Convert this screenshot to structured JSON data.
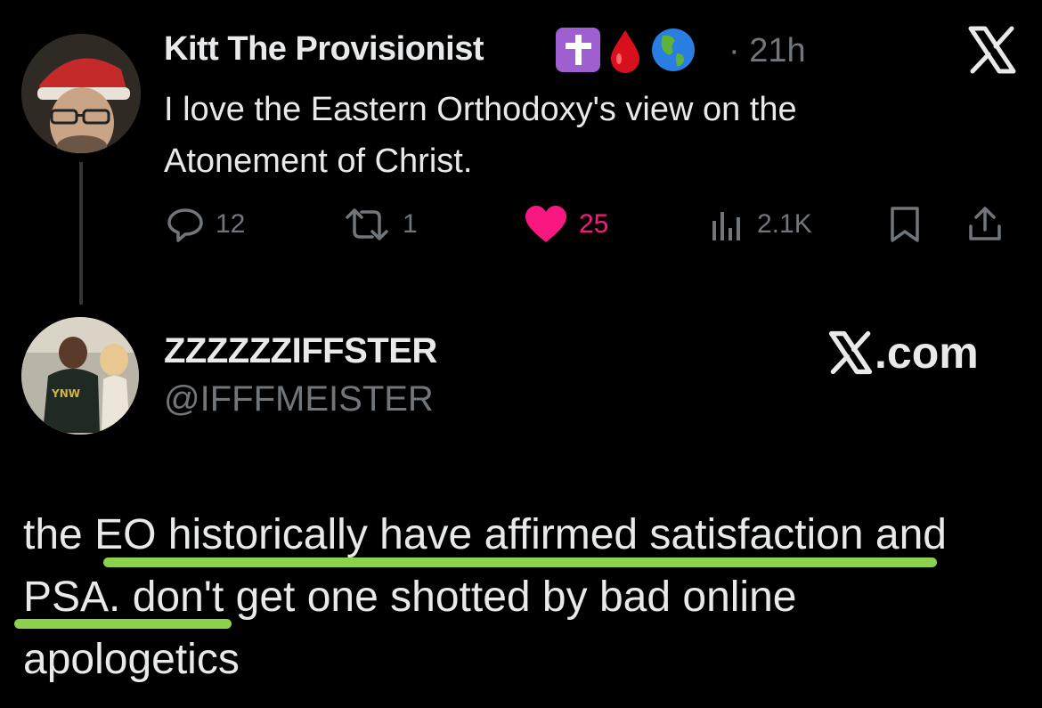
{
  "tweet": {
    "author_name": "Kitt The Provisionist",
    "badges": [
      "latin-cross-emoji",
      "drop-of-blood-emoji",
      "globe-americas-emoji"
    ],
    "separator": "·",
    "time": "21h",
    "text": "I love the Eastern Orthodoxy's view on the Atonement of Christ.",
    "actions": {
      "replies": "12",
      "reposts": "1",
      "likes": "25",
      "views": "2.1K"
    },
    "like_color": "#f91880"
  },
  "reply_card": {
    "display_name": "ZZZZZZIFFSTER",
    "handle": "@IFFFMEISTER",
    "site_label": ".com",
    "text": "the EO historically have affirmed satisfaction and PSA. don't get one shotted by bad online apologetics",
    "highlight_color": "#8cd24c"
  },
  "colors": {
    "background": "#000000",
    "text": "#e7e9ea",
    "muted": "#71767b"
  }
}
